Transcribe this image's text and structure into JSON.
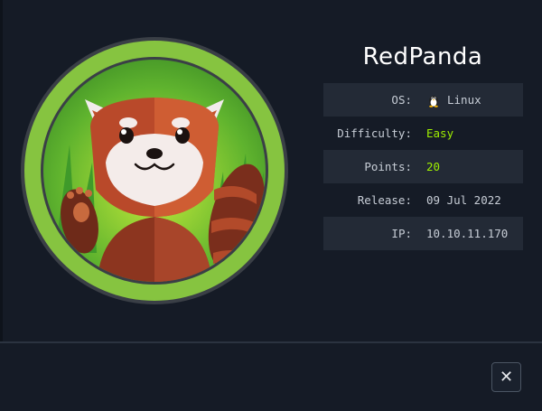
{
  "machine": {
    "name": "RedPanda"
  },
  "info": {
    "os_label": "OS:",
    "os_value": "Linux",
    "os_icon": "tux-icon",
    "difficulty_label": "Difficulty:",
    "difficulty_value": "Easy",
    "points_label": "Points:",
    "points_value": "20",
    "release_label": "Release:",
    "release_value": "09 Jul 2022",
    "ip_label": "IP:",
    "ip_value": "10.10.11.170"
  },
  "actions": {
    "close_label": "✕"
  },
  "colors": {
    "accent_green": "#9fef00",
    "ring_green": "#86c440",
    "background": "#151b26"
  }
}
